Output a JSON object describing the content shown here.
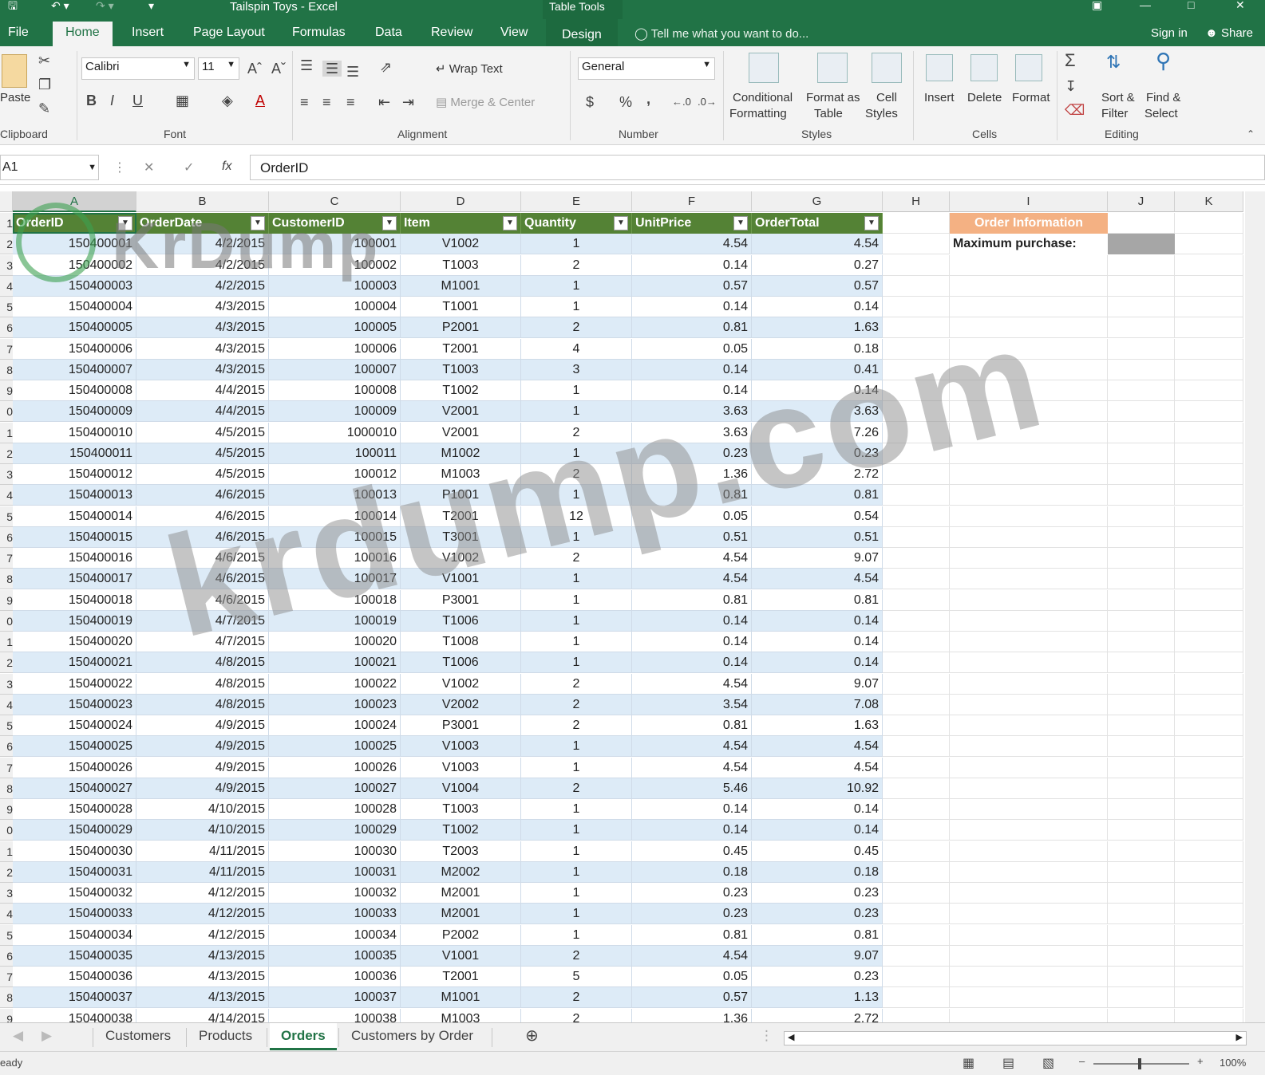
{
  "window": {
    "title": "Tailspin Toys - Excel",
    "context_tab_group": "Table Tools"
  },
  "ribbon_tabs": [
    "File",
    "Home",
    "Insert",
    "Page Layout",
    "Formulas",
    "Data",
    "Review",
    "View",
    "Design"
  ],
  "tell_me_placeholder": "Tell me what you want to do...",
  "sign_in": "Sign in",
  "share": "Share",
  "ribbon": {
    "clipboard": {
      "label": "Clipboard",
      "paste": "Paste"
    },
    "font": {
      "label": "Font",
      "name": "Calibri",
      "size": "11",
      "bold": "B",
      "italic": "I",
      "underline": "U"
    },
    "alignment": {
      "label": "Alignment",
      "wrap_text": "Wrap Text",
      "merge_center": "Merge & Center"
    },
    "number": {
      "label": "Number",
      "format": "General",
      "currency": "$",
      "percent": "%",
      "comma": ","
    },
    "styles": {
      "label": "Styles",
      "conditional_1": "Conditional",
      "conditional_2": "Formatting",
      "format_as_1": "Format as",
      "format_as_2": "Table",
      "cell_styles_1": "Cell",
      "cell_styles_2": "Styles"
    },
    "cells": {
      "label": "Cells",
      "insert": "Insert",
      "delete": "Delete",
      "format": "Format"
    },
    "editing": {
      "label": "Editing",
      "sort_1": "Sort &",
      "sort_2": "Filter",
      "find_1": "Find &",
      "find_2": "Select"
    }
  },
  "formula_bar": {
    "name_box": "A1",
    "fx": "fx",
    "formula": "OrderID"
  },
  "columns": [
    "A",
    "B",
    "C",
    "D",
    "E",
    "F",
    "G",
    "H",
    "I",
    "J",
    "K"
  ],
  "table_headers": [
    "OrderID",
    "OrderDate",
    "CustomerID",
    "Item",
    "Quantity",
    "UnitPrice",
    "OrderTotal"
  ],
  "rows": [
    [
      "150400001",
      "4/2/2015",
      "100001",
      "V1002",
      "1",
      "4.54",
      "4.54"
    ],
    [
      "150400002",
      "4/2/2015",
      "100002",
      "T1003",
      "2",
      "0.14",
      "0.27"
    ],
    [
      "150400003",
      "4/2/2015",
      "100003",
      "M1001",
      "1",
      "0.57",
      "0.57"
    ],
    [
      "150400004",
      "4/3/2015",
      "100004",
      "T1001",
      "1",
      "0.14",
      "0.14"
    ],
    [
      "150400005",
      "4/3/2015",
      "100005",
      "P2001",
      "2",
      "0.81",
      "1.63"
    ],
    [
      "150400006",
      "4/3/2015",
      "100006",
      "T2001",
      "4",
      "0.05",
      "0.18"
    ],
    [
      "150400007",
      "4/3/2015",
      "100007",
      "T1003",
      "3",
      "0.14",
      "0.41"
    ],
    [
      "150400008",
      "4/4/2015",
      "100008",
      "T1002",
      "1",
      "0.14",
      "0.14"
    ],
    [
      "150400009",
      "4/4/2015",
      "100009",
      "V2001",
      "1",
      "3.63",
      "3.63"
    ],
    [
      "150400010",
      "4/5/2015",
      "1000010",
      "V2001",
      "2",
      "3.63",
      "7.26"
    ],
    [
      "150400011",
      "4/5/2015",
      "100011",
      "M1002",
      "1",
      "0.23",
      "0.23"
    ],
    [
      "150400012",
      "4/5/2015",
      "100012",
      "M1003",
      "2",
      "1.36",
      "2.72"
    ],
    [
      "150400013",
      "4/6/2015",
      "100013",
      "P1001",
      "1",
      "0.81",
      "0.81"
    ],
    [
      "150400014",
      "4/6/2015",
      "100014",
      "T2001",
      "12",
      "0.05",
      "0.54"
    ],
    [
      "150400015",
      "4/6/2015",
      "100015",
      "T3001",
      "1",
      "0.51",
      "0.51"
    ],
    [
      "150400016",
      "4/6/2015",
      "100016",
      "V1002",
      "2",
      "4.54",
      "9.07"
    ],
    [
      "150400017",
      "4/6/2015",
      "100017",
      "V1001",
      "1",
      "4.54",
      "4.54"
    ],
    [
      "150400018",
      "4/6/2015",
      "100018",
      "P3001",
      "1",
      "0.81",
      "0.81"
    ],
    [
      "150400019",
      "4/7/2015",
      "100019",
      "T1006",
      "1",
      "0.14",
      "0.14"
    ],
    [
      "150400020",
      "4/7/2015",
      "100020",
      "T1008",
      "1",
      "0.14",
      "0.14"
    ],
    [
      "150400021",
      "4/8/2015",
      "100021",
      "T1006",
      "1",
      "0.14",
      "0.14"
    ],
    [
      "150400022",
      "4/8/2015",
      "100022",
      "V1002",
      "2",
      "4.54",
      "9.07"
    ],
    [
      "150400023",
      "4/8/2015",
      "100023",
      "V2002",
      "2",
      "3.54",
      "7.08"
    ],
    [
      "150400024",
      "4/9/2015",
      "100024",
      "P3001",
      "2",
      "0.81",
      "1.63"
    ],
    [
      "150400025",
      "4/9/2015",
      "100025",
      "V1003",
      "1",
      "4.54",
      "4.54"
    ],
    [
      "150400026",
      "4/9/2015",
      "100026",
      "V1003",
      "1",
      "4.54",
      "4.54"
    ],
    [
      "150400027",
      "4/9/2015",
      "100027",
      "V1004",
      "2",
      "5.46",
      "10.92"
    ],
    [
      "150400028",
      "4/10/2015",
      "100028",
      "T1003",
      "1",
      "0.14",
      "0.14"
    ],
    [
      "150400029",
      "4/10/2015",
      "100029",
      "T1002",
      "1",
      "0.14",
      "0.14"
    ],
    [
      "150400030",
      "4/11/2015",
      "100030",
      "T2003",
      "1",
      "0.45",
      "0.45"
    ],
    [
      "150400031",
      "4/11/2015",
      "100031",
      "M2002",
      "1",
      "0.18",
      "0.18"
    ],
    [
      "150400032",
      "4/12/2015",
      "100032",
      "M2001",
      "1",
      "0.23",
      "0.23"
    ],
    [
      "150400033",
      "4/12/2015",
      "100033",
      "M2001",
      "1",
      "0.23",
      "0.23"
    ],
    [
      "150400034",
      "4/12/2015",
      "100034",
      "P2002",
      "1",
      "0.81",
      "0.81"
    ],
    [
      "150400035",
      "4/13/2015",
      "100035",
      "V1001",
      "2",
      "4.54",
      "9.07"
    ],
    [
      "150400036",
      "4/13/2015",
      "100036",
      "T2001",
      "5",
      "0.05",
      "0.23"
    ],
    [
      "150400037",
      "4/13/2015",
      "100037",
      "M1001",
      "2",
      "0.57",
      "1.13"
    ],
    [
      "150400038",
      "4/14/2015",
      "100038",
      "M1003",
      "2",
      "1.36",
      "2.72"
    ]
  ],
  "row_numbers": [
    "1",
    "2",
    "3",
    "4",
    "5",
    "6",
    "7",
    "8",
    "9",
    "0",
    "1",
    "2",
    "3",
    "4",
    "5",
    "6",
    "7",
    "8",
    "9",
    "0",
    "1",
    "2",
    "3",
    "4",
    "5",
    "6",
    "7",
    "8",
    "9",
    "0",
    "1",
    "2",
    "3",
    "4",
    "5",
    "6",
    "7",
    "8",
    "9"
  ],
  "order_info": {
    "header": "Order Information",
    "max_label": "Maximum purchase:"
  },
  "sheet_tabs": [
    "Customers",
    "Products",
    "Orders",
    "Customers by Order"
  ],
  "active_sheet": "Orders",
  "status": {
    "ready": "eady",
    "zoom": "100%"
  },
  "watermark": {
    "small": "KrDump",
    "large": "krdump.com"
  },
  "colors": {
    "excel_green": "#217346",
    "table_header": "#548235",
    "band": "#ddebf7",
    "order_info": "#f4b183",
    "max_value": "#a6a6a6"
  }
}
